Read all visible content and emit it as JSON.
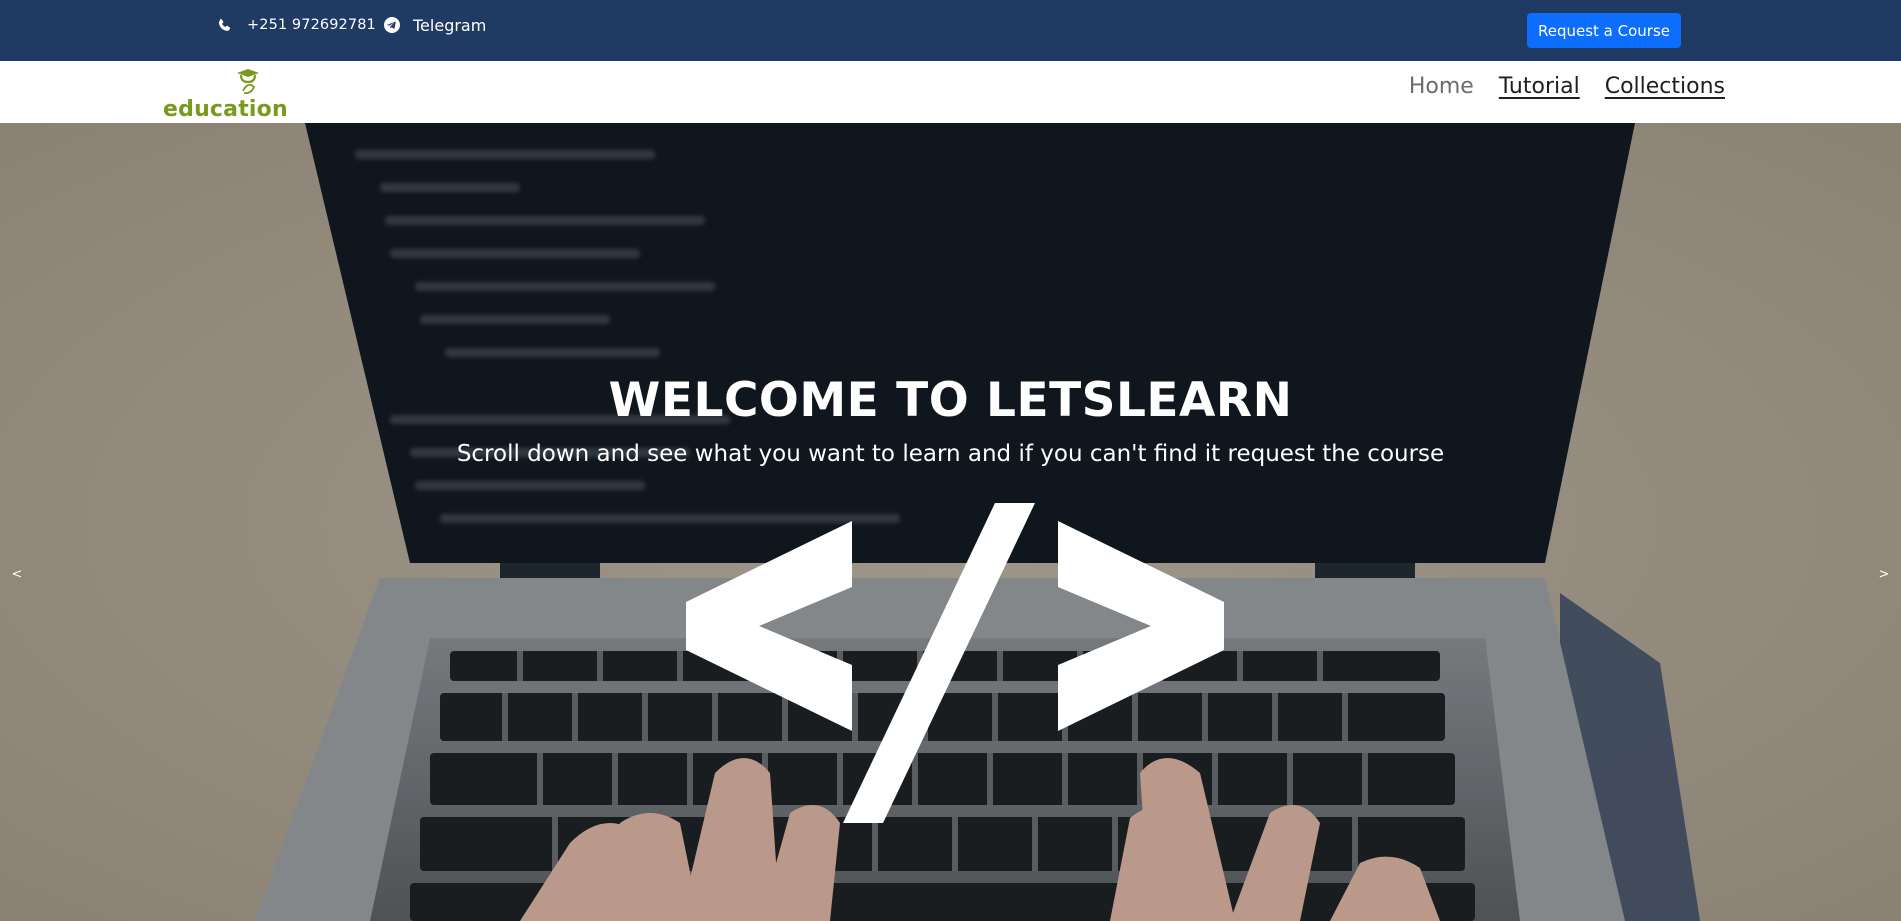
{
  "topbar": {
    "phone": {
      "icon": "phone-icon",
      "text": "+251 972692781"
    },
    "telegram": {
      "icon": "telegram-icon",
      "text": "Telegram"
    },
    "request_button": "Request a Course",
    "colors": {
      "background": "#1f3a63",
      "button": "#0d6efd"
    }
  },
  "navbar": {
    "logo": {
      "icon": "graduation-logo-icon",
      "text": "education",
      "color": "#7a9a1f"
    },
    "links": [
      {
        "label": "Home",
        "active": true
      },
      {
        "label": "Tutorial",
        "active": false
      },
      {
        "label": "Collections",
        "active": false
      }
    ]
  },
  "hero": {
    "title": "WELCOME TO LETSLEARN",
    "subtitle": "Scroll down and see what you want to learn and if you can't find it request the course",
    "icon": "code-tag-icon",
    "prev_label": "<",
    "next_label": ">"
  }
}
